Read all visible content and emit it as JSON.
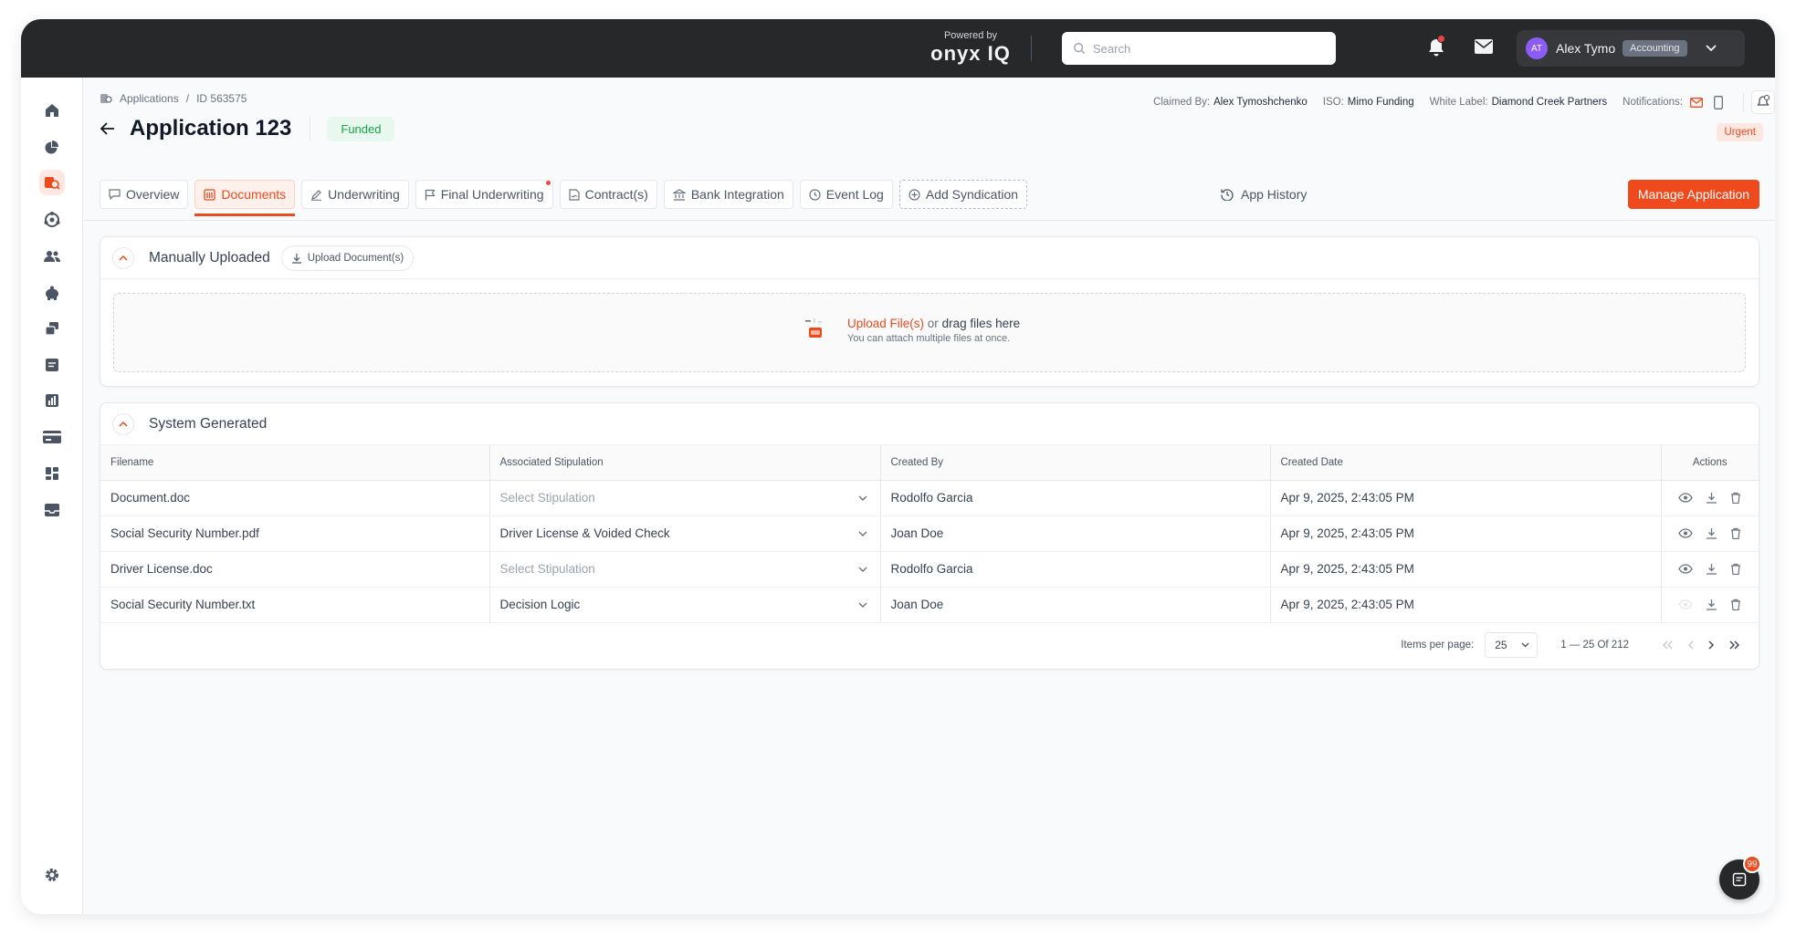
{
  "topbar": {
    "powered_by": "Powered by",
    "brand": "onyx IQ",
    "search_placeholder": "Search",
    "user": {
      "initials": "AT",
      "name": "Alex Tymo",
      "role": "Accounting"
    }
  },
  "breadcrumb": {
    "root": "Applications",
    "separator": "/",
    "current": "ID 563575"
  },
  "meta": {
    "claimed_by_label": "Claimed By:",
    "claimed_by": "Alex Tymoshchenko",
    "iso_label": "ISO:",
    "iso": "Mimo Funding",
    "white_label_label": "White Label:",
    "white_label": "Diamond Creek Partners",
    "notifications_label": "Notifications:"
  },
  "header": {
    "title": "Application 123",
    "status": "Funded",
    "urgent": "Urgent"
  },
  "tabs": [
    {
      "label": "Overview",
      "icon": "chat-icon"
    },
    {
      "label": "Documents",
      "icon": "documents-icon",
      "active": true
    },
    {
      "label": "Underwriting",
      "icon": "pencil-icon"
    },
    {
      "label": "Final Underwriting",
      "icon": "flag-icon",
      "dot": true
    },
    {
      "label": "Contract(s)",
      "icon": "contract-icon"
    },
    {
      "label": "Bank Integration",
      "icon": "bank-icon"
    },
    {
      "label": "Event Log",
      "icon": "clock-icon"
    },
    {
      "label": "Add Syndication",
      "icon": "plus-circle-icon"
    }
  ],
  "actions": {
    "app_history": "App History",
    "manage": "Manage Application"
  },
  "manual": {
    "title": "Manually Uploaded",
    "upload_button": "Upload Document(s)",
    "dz_link": "Upload File(s)",
    "dz_or": "or",
    "dz_drag": "drag files here",
    "dz_sub": "You can attach multiple files at once."
  },
  "system": {
    "title": "System Generated",
    "columns": [
      "Filename",
      "Associated Stipulation",
      "Created By",
      "Created Date",
      "Actions"
    ],
    "rows": [
      {
        "filename": "Document.doc",
        "stipulation": "Select Stipulation",
        "placeholder": true,
        "created_by": "Rodolfo Garcia",
        "created_date": "Apr 9, 2025, 2:43:05 PM",
        "view_disabled": false
      },
      {
        "filename": "Social Security Number.pdf",
        "stipulation": "Driver License & Voided Check",
        "placeholder": false,
        "created_by": "Joan Doe",
        "created_date": "Apr 9, 2025, 2:43:05 PM",
        "view_disabled": false
      },
      {
        "filename": "Driver License.doc",
        "stipulation": "Select Stipulation",
        "placeholder": true,
        "created_by": "Rodolfo Garcia",
        "created_date": "Apr 9, 2025, 2:43:05 PM",
        "view_disabled": false
      },
      {
        "filename": "Social Security Number.txt",
        "stipulation": "Decision Logic",
        "placeholder": false,
        "created_by": "Joan Doe",
        "created_date": "Apr 9, 2025, 2:43:05 PM",
        "view_disabled": true
      }
    ],
    "pagination": {
      "items_per_page_label": "Items per page:",
      "per_page": "25",
      "range": "1 — 25 Of 212"
    }
  },
  "help": {
    "badge": "99"
  },
  "colors": {
    "accent": "#ef4a1d",
    "topbar": "#27282a",
    "success": "#16a34a"
  }
}
